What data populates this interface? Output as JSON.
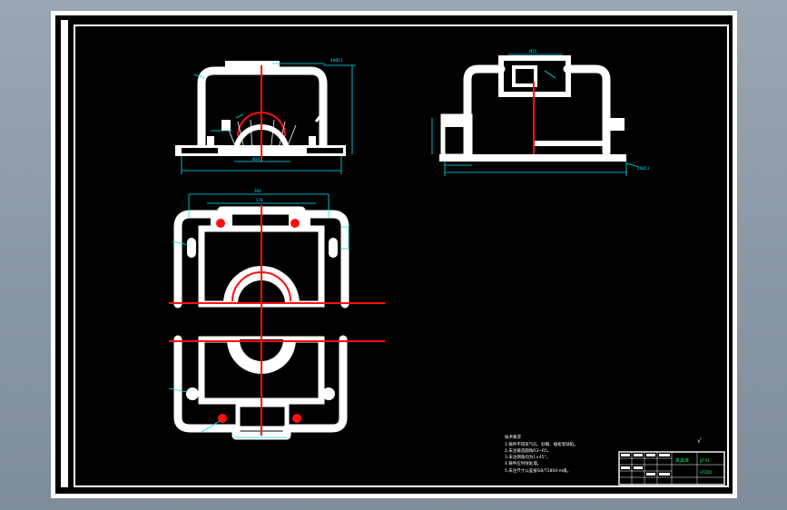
{
  "drawing": {
    "background": "#000000",
    "sheet_color": "#ffffff",
    "part_color": "#ffffff",
    "centerline_color": "#ff1010",
    "dimension_color": "#00e5ff",
    "annotation_color": "#ffffff",
    "label_color": "#00ff66"
  },
  "top_view": {
    "dim_overall": "Ø20",
    "dim_callout": "4XØ13"
  },
  "side_view": {
    "dim_top": "Ø25",
    "dim_callout": "2XØ13"
  },
  "plan_view": {
    "dim_overall": "260",
    "dim_inner": "178"
  },
  "notes": {
    "heading": "技术要求",
    "lines": [
      "1.铸件不得有气孔、砂眼、缩松等缺陷。",
      "2.未注铸造圆角R3~R5。",
      "3.未注倒角均为1×45°。",
      "4.铸件应时效处理。",
      "5.未注尺寸公差按GB/T1804-m级。"
    ]
  },
  "title_block": {
    "part_name": "夹具体",
    "drawing_no": "JJT-01",
    "material": "HT200"
  },
  "roughness_mark": "√"
}
